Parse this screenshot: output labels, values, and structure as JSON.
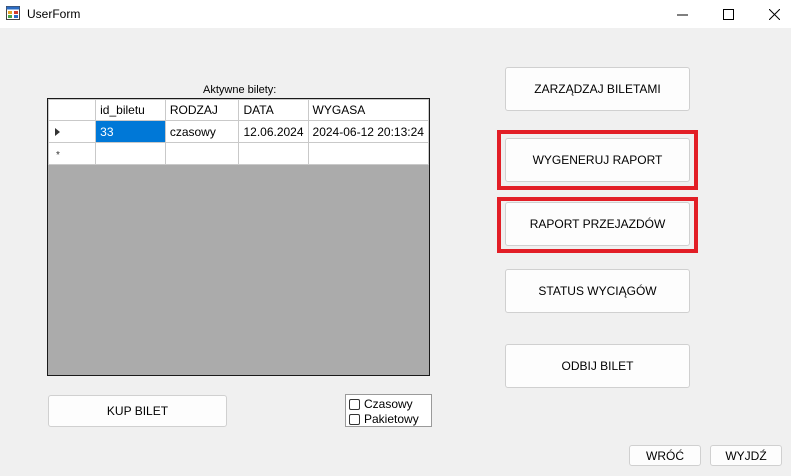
{
  "window": {
    "title": "UserForm",
    "icon": "winforms-app-icon",
    "controls": [
      "minimize-icon",
      "maximize-icon",
      "close-icon"
    ]
  },
  "grid": {
    "caption": "Aktywne bilety:",
    "columns": [
      "id_biletu",
      "RODZAJ",
      "DATA",
      "WYGASA"
    ],
    "rows": [
      [
        "33",
        "czasowy",
        "12.06.2024",
        "2024-06-12 20:13:24"
      ]
    ],
    "new_row_marker": "*"
  },
  "buttons": {
    "manage_tickets": "ZARZĄDZAJ BILETAMI",
    "generate_report": "WYGENERUJ RAPORT",
    "rides_report": "RAPORT PRZEJAZDÓW",
    "lift_status": "STATUS WYCIĄGÓW",
    "stamp_ticket": "ODBIJ BILET",
    "buy_ticket": "KUP BILET",
    "back": "WRÓĆ",
    "exit": "WYJDŹ"
  },
  "ticket_type": {
    "options": [
      {
        "label": "Czasowy",
        "checked": false
      },
      {
        "label": "Pakietowy",
        "checked": false
      }
    ]
  },
  "colors": {
    "highlight": "#e21e26",
    "selection": "#0078d7",
    "grid_background": "#ababab"
  }
}
